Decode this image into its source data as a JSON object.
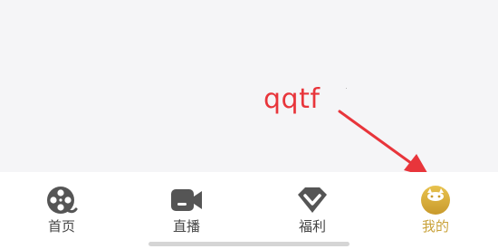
{
  "annotation": {
    "text": "qqtf",
    "color": "#e8353b"
  },
  "tabbar": {
    "active_color": "#c9a23a",
    "items": [
      {
        "label": "首页",
        "icon": "film-reel-icon",
        "active": false
      },
      {
        "label": "直播",
        "icon": "video-camera-icon",
        "active": false
      },
      {
        "label": "福利",
        "icon": "gift-diamond-icon",
        "active": false
      },
      {
        "label": "我的",
        "icon": "profile-avatar-icon",
        "active": true
      }
    ]
  }
}
